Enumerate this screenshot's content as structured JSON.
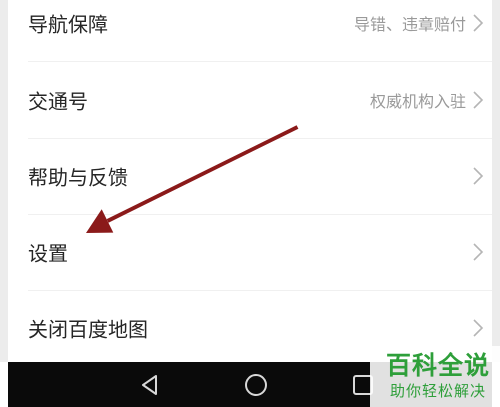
{
  "menu": {
    "items": [
      {
        "label": "导航保障",
        "sub": "导错、违章赔付"
      },
      {
        "label": "交通号",
        "sub": "权威机构入驻"
      },
      {
        "label": "帮助与反馈",
        "sub": ""
      },
      {
        "label": "设置",
        "sub": ""
      },
      {
        "label": "关闭百度地图",
        "sub": ""
      }
    ]
  },
  "annotation": {
    "arrow_color": "#8b1a1a"
  },
  "navbar": {
    "buttons": [
      "back-icon",
      "home-icon",
      "recents-icon"
    ]
  },
  "watermark": {
    "title": "百科全说",
    "subtitle": "助你轻松解决",
    "color": "#2e9f3a"
  }
}
